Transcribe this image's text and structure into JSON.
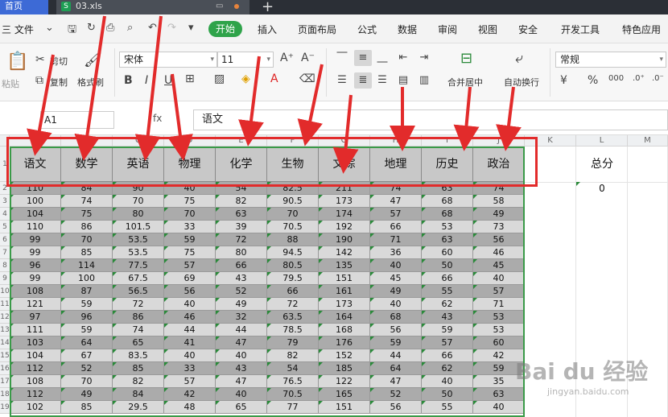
{
  "titlebar": {
    "home_tab": "首页",
    "file_tab": "03.xls",
    "file_icon": "S",
    "add_tab": "+"
  },
  "menubar": {
    "file_menu": "三 文件",
    "items": [
      "开始",
      "插入",
      "页面布局",
      "公式",
      "数据",
      "审阅",
      "视图",
      "安全",
      "开发工具",
      "特色应用"
    ]
  },
  "ribbon": {
    "paste": "粘贴",
    "cut": "剪切",
    "copy": "复制",
    "format_painter": "格式刷",
    "font_name": "宋体",
    "font_size": "11",
    "bold": "B",
    "italic": "I",
    "underline": "U",
    "merge_center": "合并居中",
    "wrap_text": "自动换行",
    "number_format": "常规",
    "percent": "%",
    "currency": "¥"
  },
  "formula_bar": {
    "cell_ref": "A1",
    "fx": "fx",
    "content": "语文"
  },
  "columns": [
    "A",
    "B",
    "C",
    "D",
    "E",
    "F",
    "G",
    "H",
    "I",
    "J",
    "K",
    "L",
    "M"
  ],
  "headers": [
    "语文",
    "数学",
    "英语",
    "物理",
    "化学",
    "生物",
    "文综",
    "地理",
    "历史",
    "政治"
  ],
  "total_header": "总分",
  "total_first_value": "0",
  "rows": [
    [
      "110",
      "84",
      "90",
      "40",
      "54",
      "82.5",
      "211",
      "74",
      "63",
      "74"
    ],
    [
      "100",
      "74",
      "70",
      "75",
      "82",
      "90.5",
      "173",
      "47",
      "68",
      "58"
    ],
    [
      "104",
      "75",
      "80",
      "70",
      "63",
      "70",
      "174",
      "57",
      "68",
      "49"
    ],
    [
      "110",
      "86",
      "101.5",
      "33",
      "39",
      "70.5",
      "192",
      "66",
      "53",
      "73"
    ],
    [
      "99",
      "70",
      "53.5",
      "59",
      "72",
      "88",
      "190",
      "71",
      "63",
      "56"
    ],
    [
      "99",
      "85",
      "53.5",
      "75",
      "80",
      "94.5",
      "142",
      "36",
      "60",
      "46"
    ],
    [
      "96",
      "114",
      "77.5",
      "57",
      "66",
      "80.5",
      "135",
      "40",
      "50",
      "45"
    ],
    [
      "99",
      "100",
      "67.5",
      "69",
      "43",
      "79.5",
      "151",
      "45",
      "66",
      "40"
    ],
    [
      "108",
      "87",
      "56.5",
      "56",
      "52",
      "66",
      "161",
      "49",
      "55",
      "57"
    ],
    [
      "121",
      "59",
      "72",
      "40",
      "49",
      "72",
      "173",
      "40",
      "62",
      "71"
    ],
    [
      "97",
      "96",
      "86",
      "46",
      "32",
      "63.5",
      "164",
      "68",
      "43",
      "53"
    ],
    [
      "111",
      "59",
      "74",
      "44",
      "44",
      "78.5",
      "168",
      "56",
      "59",
      "53"
    ],
    [
      "103",
      "64",
      "65",
      "41",
      "47",
      "79",
      "176",
      "59",
      "57",
      "60"
    ],
    [
      "104",
      "67",
      "83.5",
      "40",
      "40",
      "82",
      "152",
      "44",
      "66",
      "42"
    ],
    [
      "112",
      "52",
      "85",
      "33",
      "43",
      "54",
      "185",
      "64",
      "62",
      "59"
    ],
    [
      "108",
      "70",
      "82",
      "57",
      "47",
      "76.5",
      "122",
      "47",
      "40",
      "35"
    ],
    [
      "112",
      "49",
      "84",
      "42",
      "40",
      "70.5",
      "165",
      "52",
      "50",
      "63"
    ],
    [
      "102",
      "85",
      "29.5",
      "48",
      "65",
      "77",
      "151",
      "56",
      "55",
      "40"
    ]
  ],
  "row_numbers": [
    "1",
    "2",
    "3",
    "4",
    "5",
    "6",
    "7",
    "8",
    "9",
    "10",
    "11",
    "12",
    "13",
    "14",
    "15",
    "16",
    "17",
    "18",
    "19"
  ],
  "watermark": {
    "line1": "Bai du 经验",
    "line2": "jingyan.baidu.com"
  },
  "colors": {
    "accent_green": "#2fa34a",
    "annotation_red": "#e22b2b",
    "header_fill": "#c8c8c8",
    "row_dark": "#ababab",
    "row_light": "#d9d9d9"
  }
}
